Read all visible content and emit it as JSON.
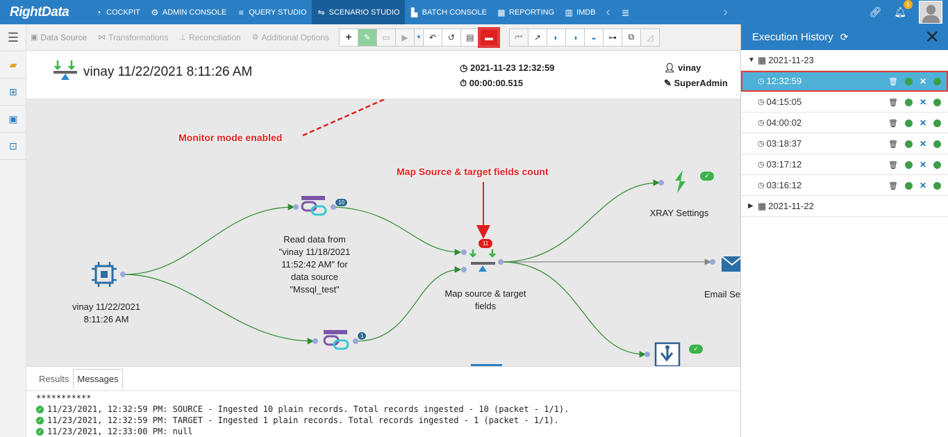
{
  "nav": {
    "brand": "RightData",
    "items": [
      {
        "label": "COCKPIT",
        "icon": "cockpit-icon",
        "glyph": "◔",
        "active": false
      },
      {
        "label": "ADMIN CONSOLE",
        "icon": "gear-icon",
        "glyph": "⚙",
        "active": false
      },
      {
        "label": "QUERY STUDIO",
        "icon": "database-icon",
        "glyph": "≡",
        "active": false
      },
      {
        "label": "SCENARIO STUDIO",
        "icon": "scenario-icon",
        "glyph": "⇋",
        "active": true
      },
      {
        "label": "BATCH CONSOLE",
        "icon": "batch-icon",
        "glyph": "▙",
        "active": false
      },
      {
        "label": "REPORTING",
        "icon": "report-icon",
        "glyph": "▦",
        "active": false
      },
      {
        "label": "IMDB",
        "icon": "imdb-icon",
        "glyph": "▥",
        "active": false
      }
    ],
    "notifications": "5"
  },
  "toolbar": {
    "links": [
      {
        "label": "Data Source",
        "icon": "data-source-icon"
      },
      {
        "label": "Transformations",
        "icon": "transform-icon"
      },
      {
        "label": "Reconciliation",
        "icon": "reconcile-icon"
      },
      {
        "label": "Additional Options",
        "icon": "options-icon"
      }
    ]
  },
  "run": {
    "title": "vinay 11/22/2021 8:11:26 AM",
    "timestamp": "2021-11-23 12:32:59",
    "duration": "00:00:00.515",
    "user": "vinay",
    "role": "SuperAdmin"
  },
  "canvas": {
    "annotations": {
      "monitor": "Monitor mode enabled",
      "map_count": "Map Source & target fields count"
    },
    "nodes": {
      "source": "vinay 11/22/2021\n8:11:26 AM",
      "read_data": "Read data from\n\"vinay 11/18/2021\n11:52:42 AM\" for\ndata source\n\"Mssql_test\"",
      "map": "Map source & target\nfields",
      "xray": "XRAY Settings",
      "email": "Email Se"
    },
    "badges": {
      "read_top": "10",
      "read_bottom": "1",
      "map_count": "11"
    }
  },
  "messages": {
    "tabs": [
      "Results",
      "Messages"
    ],
    "active_tab": "Messages",
    "lines": [
      "***********",
      "11/23/2021, 12:32:59 PM: SOURCE - Ingested 10 plain records. Total records ingested - 10 (packet - 1/1).",
      "11/23/2021, 12:32:59 PM: TARGET - Ingested 1 plain records. Total records ingested - 1 (packet - 1/1).",
      "11/23/2021, 12:33:00 PM: null"
    ]
  },
  "history": {
    "title": "Execution History",
    "groups": [
      {
        "date": "2021-11-23",
        "expanded": true,
        "times": [
          "12:32:59",
          "04:15:05",
          "04:00:02",
          "03:18:37",
          "03:17:12",
          "03:16:12"
        ]
      },
      {
        "date": "2021-11-22",
        "expanded": false,
        "times": []
      }
    ],
    "selected": "12:32:59"
  },
  "colors": {
    "nav": "#2a7fc4",
    "nav_active": "#1a5e99",
    "annotation": "#e02020",
    "flow_line": "#2e8b2e",
    "selected_row": "#4fb1d8"
  }
}
